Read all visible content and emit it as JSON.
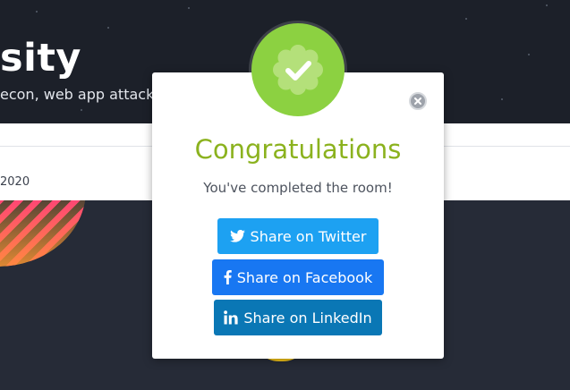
{
  "hero": {
    "title": "sity",
    "subtitle": "econ, web app attacks"
  },
  "page": {
    "date_fragment": "2020"
  },
  "modal": {
    "title": "Congratulations",
    "subtitle": "You've completed the room!",
    "close_icon": "close-icon",
    "badge_icon": "check-badge-icon",
    "buttons": {
      "twitter": "Share on Twitter",
      "facebook": "Share on Facebook",
      "linkedin": "Share on LinkedIn"
    }
  },
  "colors": {
    "badge_green": "#8cd141",
    "title_green": "#8bb21e",
    "twitter": "#1da1f2",
    "facebook": "#1877f2",
    "linkedin": "#0a77b5"
  }
}
